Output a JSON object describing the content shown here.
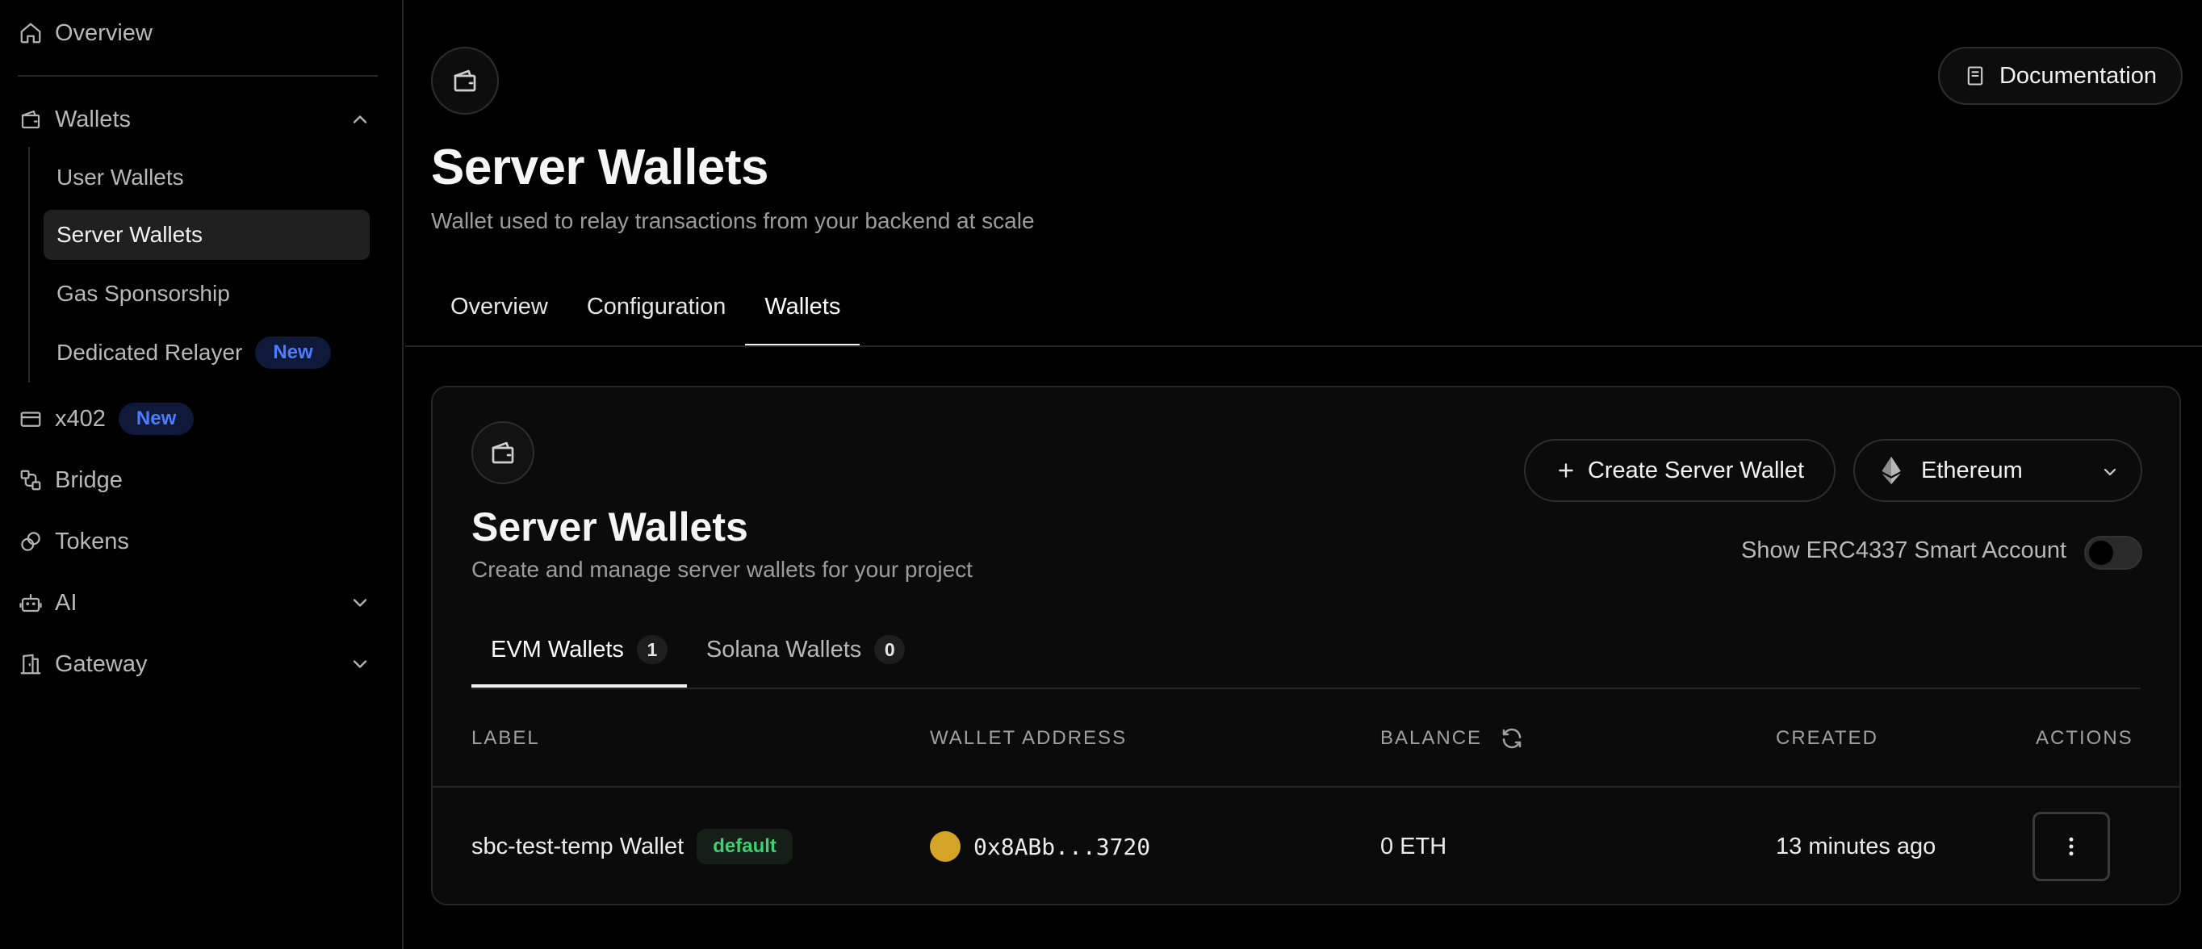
{
  "sidebar": {
    "overview": "Overview",
    "wallets": "Wallets",
    "wallet_items": [
      {
        "label": "User Wallets"
      },
      {
        "label": "Server Wallets"
      },
      {
        "label": "Gas Sponsorship"
      },
      {
        "label": "Dedicated Relayer",
        "badge": "New"
      }
    ],
    "x402": "x402",
    "x402_badge": "New",
    "bridge": "Bridge",
    "tokens": "Tokens",
    "ai": "AI",
    "gateway": "Gateway"
  },
  "header": {
    "documentation": "Documentation",
    "title": "Server Wallets",
    "subtitle": "Wallet used to relay transactions from your backend at scale",
    "tabs": [
      "Overview",
      "Configuration",
      "Wallets"
    ],
    "active_tab": "Wallets"
  },
  "card": {
    "title": "Server Wallets",
    "subtitle": "Create and manage server wallets for your project",
    "create_button": "Create Server Wallet",
    "chain": "Ethereum",
    "erc_label": "Show ERC4337 Smart Account",
    "erc_enabled": false,
    "subtabs": [
      {
        "label": "EVM Wallets",
        "count": "1"
      },
      {
        "label": "Solana Wallets",
        "count": "0"
      }
    ],
    "active_subtab": "EVM Wallets",
    "columns": {
      "label": "LABEL",
      "address": "WALLET ADDRESS",
      "balance": "BALANCE",
      "created": "CREATED",
      "actions": "ACTIONS"
    },
    "rows": [
      {
        "label": "sbc-test-temp Wallet",
        "badge": "default",
        "address": "0x8ABb...3720",
        "balance": "0 ETH",
        "created": "13 minutes ago"
      }
    ]
  },
  "colors": {
    "background": "#000000",
    "accent_badge": "#4d7cff",
    "default_badge": "#3fcf6e",
    "coin": "#d3a426"
  }
}
